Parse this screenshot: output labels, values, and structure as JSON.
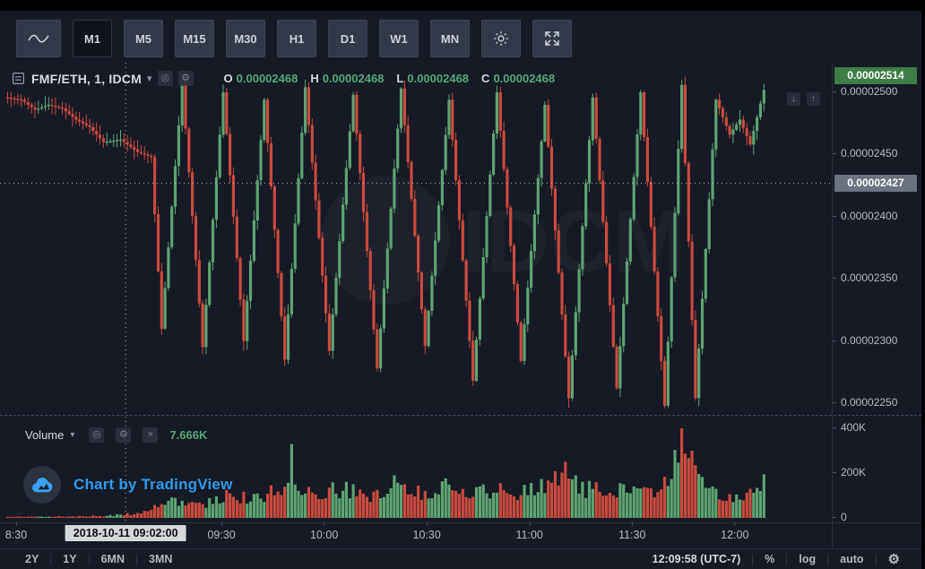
{
  "toolbar": {
    "line_tool": "line-chart",
    "buttons": [
      {
        "label": "M1",
        "active": true
      },
      {
        "label": "M5",
        "active": false
      },
      {
        "label": "M15",
        "active": false
      },
      {
        "label": "M30",
        "active": false
      },
      {
        "label": "H1",
        "active": false
      },
      {
        "label": "D1",
        "active": false
      },
      {
        "label": "W1",
        "active": false
      },
      {
        "label": "MN",
        "active": false
      }
    ],
    "settings_icon": "gear",
    "fullscreen_icon": "expand-arrows"
  },
  "header": {
    "symbol": "FMF/ETH, 1, IDCM",
    "dropdown_caret": "▾",
    "ohlc": {
      "o_key": "O",
      "o": "0.00002468",
      "h_key": "H",
      "h": "0.00002468",
      "l_key": "L",
      "l": "0.00002468",
      "c_key": "C",
      "c": "0.00002468"
    }
  },
  "pane_buttons": {
    "down": "↓",
    "up": "↑"
  },
  "price_axis": {
    "last_price": "0.00002514",
    "crosshair_price": "0.00002427",
    "ticks": [
      {
        "label": "0.00002500"
      },
      {
        "label": "0.00002450"
      },
      {
        "label": "0.00002400"
      },
      {
        "label": "0.00002350"
      },
      {
        "label": "0.00002300"
      },
      {
        "label": "0.00002250"
      }
    ]
  },
  "volume_axis": {
    "ticks": [
      {
        "label": "400K"
      },
      {
        "label": "200K"
      },
      {
        "label": "0"
      }
    ]
  },
  "volume_header": {
    "label": "Volume",
    "caret": "▾",
    "eye_icon": "◎",
    "gear_icon": "⚙",
    "close_icon": "×",
    "value": "7.666K"
  },
  "attribution": {
    "text": "Chart by TradingView"
  },
  "time_axis": {
    "crosshair_time": "2018-10-11 09:02:00",
    "labels": [
      {
        "label": "8:30"
      },
      {
        "label": "09:30"
      },
      {
        "label": "10:00"
      },
      {
        "label": "10:30"
      },
      {
        "label": "11:00"
      },
      {
        "label": "11:30"
      },
      {
        "label": "12:00"
      }
    ]
  },
  "bottom_bar": {
    "ranges": [
      {
        "label": "2Y"
      },
      {
        "label": "1Y"
      },
      {
        "label": "6MN"
      },
      {
        "label": "3MN"
      }
    ],
    "clock": "12:09:58 (UTC-7)",
    "percent": "%",
    "log": "log",
    "auto": "auto",
    "gear": "⚙"
  },
  "colors": {
    "up": "#5fa372",
    "down": "#ca4a3f",
    "ohlc_value": "#57a877",
    "volume_value": "#57a877",
    "last_price_bg": "#3e7d46",
    "crosshair_label_bg": "#6b7280",
    "tradingview_blue": "#2f9bef",
    "crosshair_line": "#aeb4c2",
    "background": "#151a25"
  },
  "chart_data": {
    "type": "candlestick",
    "symbol": "FMF/ETH",
    "interval": "1",
    "exchange": "IDCM",
    "watermark": "IDCM",
    "price_unit": "1e-8 ETH",
    "ohlc_readout": {
      "open": "0.00002468",
      "high": "0.00002468",
      "low": "0.00002468",
      "close": "0.00002468"
    },
    "last_price_value": 2514,
    "crosshair": {
      "price_value": 2427,
      "minute": 32,
      "time": "2018-10-11 09:02:00"
    },
    "y_ticks_value": [
      2500,
      2450,
      2400,
      2350,
      2300,
      2250
    ],
    "ylim_value": [
      2243,
      2524
    ],
    "x_tick_minutes": [
      0,
      60,
      90,
      120,
      150,
      180,
      210
    ],
    "x_start_label": "8:30",
    "minutes_span": [
      -3,
      219
    ],
    "price_path": [
      [
        -3,
        2496
      ],
      [
        2,
        2494
      ],
      [
        6,
        2486
      ],
      [
        10,
        2490
      ],
      [
        14,
        2487
      ],
      [
        18,
        2478
      ],
      [
        22,
        2472
      ],
      [
        26,
        2460
      ],
      [
        31,
        2462
      ],
      [
        36,
        2452
      ],
      [
        40,
        2448
      ],
      [
        43,
        2310
      ],
      [
        49,
        2506
      ],
      [
        55,
        2295
      ],
      [
        61,
        2500
      ],
      [
        67,
        2300
      ],
      [
        73,
        2494
      ],
      [
        79,
        2285
      ],
      [
        85,
        2504
      ],
      [
        92,
        2292
      ],
      [
        99,
        2498
      ],
      [
        106,
        2278
      ],
      [
        113,
        2503
      ],
      [
        120,
        2296
      ],
      [
        127,
        2494
      ],
      [
        134,
        2268
      ],
      [
        141,
        2500
      ],
      [
        148,
        2284
      ],
      [
        155,
        2490
      ],
      [
        162,
        2254
      ],
      [
        169,
        2496
      ],
      [
        176,
        2262
      ],
      [
        183,
        2500
      ],
      [
        190,
        2248
      ],
      [
        195,
        2506
      ],
      [
        199,
        2254
      ],
      [
        205,
        2494
      ],
      [
        209,
        2466
      ],
      [
        212,
        2478
      ],
      [
        215,
        2458
      ],
      [
        219,
        2502
      ]
    ],
    "volume": {
      "label": "Volume",
      "current_value": "7.666K",
      "ylim_k": [
        0,
        440
      ],
      "envelope_path_k": [
        [
          -3,
          6
        ],
        [
          10,
          8
        ],
        [
          25,
          12
        ],
        [
          35,
          25
        ],
        [
          40,
          60
        ],
        [
          48,
          110
        ],
        [
          55,
          90
        ],
        [
          62,
          140
        ],
        [
          70,
          110
        ],
        [
          80,
          210
        ],
        [
          88,
          150
        ],
        [
          95,
          170
        ],
        [
          103,
          130
        ],
        [
          110,
          200
        ],
        [
          118,
          160
        ],
        [
          125,
          190
        ],
        [
          133,
          140
        ],
        [
          140,
          180
        ],
        [
          148,
          150
        ],
        [
          155,
          200
        ],
        [
          160,
          230
        ],
        [
          166,
          170
        ],
        [
          172,
          200
        ],
        [
          180,
          150
        ],
        [
          188,
          180
        ],
        [
          194,
          400
        ],
        [
          197,
          300
        ],
        [
          202,
          160
        ],
        [
          208,
          120
        ],
        [
          213,
          150
        ],
        [
          218,
          190
        ],
        [
          219,
          60
        ]
      ],
      "spikes": [
        [
          80,
          330,
          "up"
        ],
        [
          160,
          250,
          "down"
        ],
        [
          194,
          400,
          "down"
        ],
        [
          197,
          300,
          "down"
        ],
        [
          218,
          195,
          "up"
        ]
      ]
    },
    "render": {
      "seed": 11,
      "candle_width": 3.2
    }
  }
}
